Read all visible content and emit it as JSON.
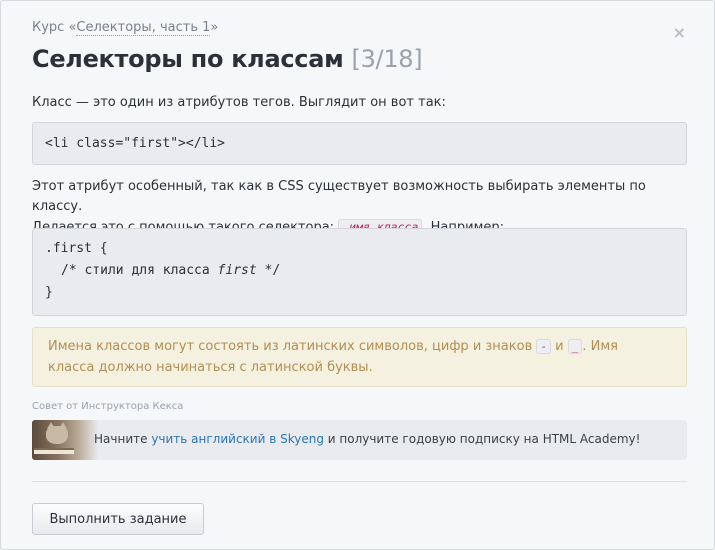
{
  "breadcrumb": {
    "prefix": "Курс «",
    "course": "Селекторы, часть 1",
    "suffix": "»"
  },
  "close_label": "×",
  "title": {
    "text": "Селекторы по классам",
    "counter": "[3/18]"
  },
  "intro": "Класс — это один из атрибутов тегов. Выглядит он вот так:",
  "code1": "<li class=\"first\"></li>",
  "para2": {
    "line1": "Этот атрибут особенный, так как в CSS существует возможность выбирать элементы по классу.",
    "line2_before": "Делается это с помощью такого селектора: ",
    "inline_code": ".имя_класса",
    "line2_after": ". Например:"
  },
  "code2": {
    "line1": ".first {",
    "line2_before": "/* стили для класса ",
    "line2_em": "first",
    "line2_after": " */",
    "line3": "}"
  },
  "hint": {
    "part1": "Имена классов могут состоять из латинских символов, цифр и знаков ",
    "key1": "-",
    "part2": " и ",
    "key2": "_",
    "part3": ". Имя",
    "line2": "класса должно начинаться с латинской буквы."
  },
  "advice_label": "Совет от Инструктора Кекса",
  "ad": {
    "before": "Начните ",
    "link": "учить английский в Skyeng",
    "after": " и получите годовую подписку на HTML Academy!"
  },
  "submit_label": "Выполнить задание",
  "colors": {
    "accent_link": "#2a76b4",
    "inline_code": "#c0245a",
    "hint_text": "#b38e52",
    "hint_bg": "#f4f1e0"
  }
}
